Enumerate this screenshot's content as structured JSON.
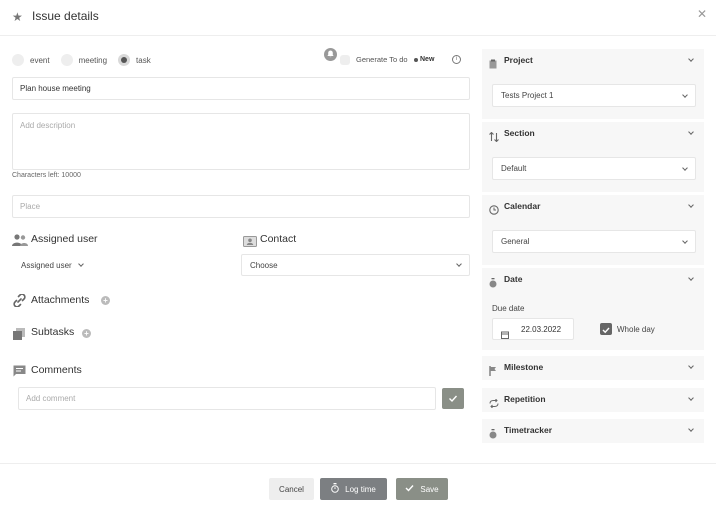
{
  "header": {
    "title": "Issue details",
    "star_icon": "star-icon",
    "close_icon": "close-icon"
  },
  "type_options": {
    "items": [
      "event",
      "meeting",
      "task"
    ],
    "selected": "task"
  },
  "generate_todo": {
    "label": "Generate To do",
    "badge": "New"
  },
  "form": {
    "title_value": "Plan house meeting",
    "description_placeholder": "Add description",
    "characters_left": "Characters left: 10000",
    "place_placeholder": "Place"
  },
  "assigned_user": {
    "heading": "Assigned user",
    "select_value": "Assigned user"
  },
  "contact": {
    "heading": "Contact",
    "select_value": "Choose"
  },
  "attachments": {
    "heading": "Attachments"
  },
  "subtasks": {
    "heading": "Subtasks"
  },
  "comments": {
    "heading": "Comments",
    "placeholder": "Add comment"
  },
  "sidebar": {
    "project": {
      "title": "Project",
      "value": "Tests Project 1"
    },
    "section": {
      "title": "Section",
      "value": "Default"
    },
    "calendar": {
      "title": "Calendar",
      "value": "General"
    },
    "date": {
      "title": "Date",
      "due_label": "Due date",
      "due_value": "22.03.2022",
      "whole_day_label": "Whole day",
      "whole_day_checked": true
    },
    "milestone": {
      "title": "Milestone"
    },
    "repetition": {
      "title": "Repetition"
    },
    "timetracker": {
      "title": "Timetracker"
    }
  },
  "footer": {
    "cancel_label": "Cancel",
    "log_time_label": "Log time",
    "save_label": "Save"
  },
  "colors": {
    "accent": "#8a8f87",
    "log_button": "#7c7f82",
    "panel_bg": "#f7f7f7"
  }
}
